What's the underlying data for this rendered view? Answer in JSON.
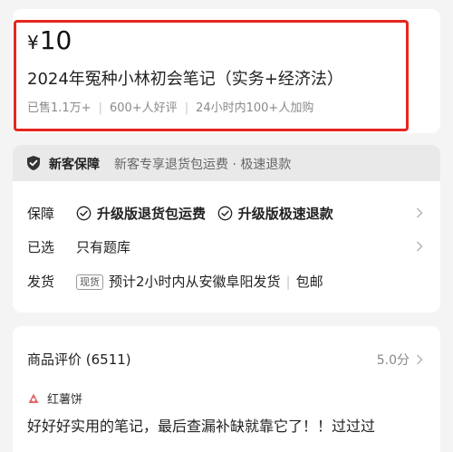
{
  "price": {
    "currency": "¥",
    "amount": "10"
  },
  "title": "2024年冤种小林初会笔记（实务+经济法）",
  "stats": [
    "已售1.1万+",
    "600+人好评",
    "24小时内100+人加购"
  ],
  "guarantee_bar": {
    "title": "新客保障",
    "desc": "新客专享退货包运费 · 极速退款"
  },
  "rows": {
    "protection": {
      "label": "保障",
      "item1": "升级版退货包运费",
      "item2": "升级版极速退款"
    },
    "selected": {
      "label": "已选",
      "value": "只有题库"
    },
    "shipping": {
      "label": "发货",
      "tag": "现货",
      "text": "预计2小时内从安徽阜阳发货",
      "extra": "包邮"
    }
  },
  "reviews": {
    "header": "商品评价 (6511)",
    "score": "5.0分",
    "user": "红薯饼",
    "text": "好好好实用的笔记，最后查漏补缺就靠它了！！过过过"
  },
  "colors": {
    "highlight": "#e5261f",
    "muted": "#8a8a8a",
    "bar": "#e9e9e9"
  }
}
